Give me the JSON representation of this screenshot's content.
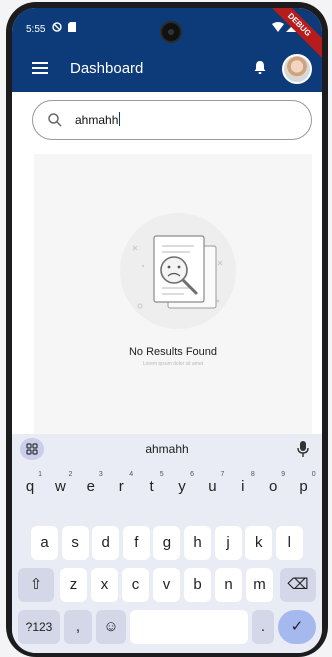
{
  "status_bar": {
    "time": "5:55",
    "ribbon": "DEBUG"
  },
  "app_bar": {
    "title": "Dashboard"
  },
  "search": {
    "value": "ahmahh"
  },
  "empty_state": {
    "title": "No Results Found",
    "subtitle": "Lorem ipsum dolor sit amet"
  },
  "keyboard": {
    "suggestion": "ahmahh",
    "row1": [
      {
        "l": "q",
        "n": "1"
      },
      {
        "l": "w",
        "n": "2"
      },
      {
        "l": "e",
        "n": "3"
      },
      {
        "l": "r",
        "n": "4"
      },
      {
        "l": "t",
        "n": "5"
      },
      {
        "l": "y",
        "n": "6"
      },
      {
        "l": "u",
        "n": "7"
      },
      {
        "l": "i",
        "n": "8"
      },
      {
        "l": "o",
        "n": "9"
      },
      {
        "l": "p",
        "n": "0"
      }
    ],
    "row2": [
      "a",
      "s",
      "d",
      "f",
      "g",
      "h",
      "j",
      "k",
      "l"
    ],
    "row3": [
      "z",
      "x",
      "c",
      "v",
      "b",
      "n",
      "m"
    ],
    "shift": "⇧",
    "backspace": "⌫",
    "symbols": "?123",
    "comma": ",",
    "emoji": "☺",
    "period": ".",
    "enter": "✓"
  },
  "colors": {
    "app_bar": "#0d3b7a",
    "keyboard_bg": "#e9ebf5",
    "enter_key": "#a6b9ee"
  }
}
